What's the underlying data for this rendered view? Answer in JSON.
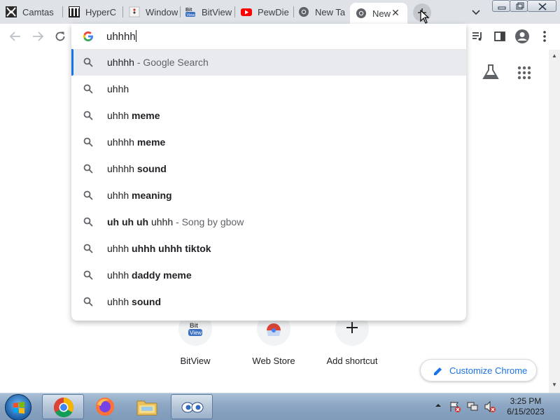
{
  "tabs": [
    {
      "title": "Camtas",
      "icon": "camtasia-icon"
    },
    {
      "title": "HyperC",
      "icon": "hypercam-icon"
    },
    {
      "title": "Window",
      "icon": "windows-icon"
    },
    {
      "title": "BitView",
      "icon": "bitview-icon"
    },
    {
      "title": "PewDie",
      "icon": "youtube-icon"
    },
    {
      "title": "New Ta",
      "icon": "chrome-icon"
    },
    {
      "title": "New",
      "icon": "chrome-icon",
      "active": true
    }
  ],
  "omnibox": {
    "text": "uhhhh"
  },
  "suggestions": [
    {
      "normal": "uhhhh",
      "bold": "",
      "desc": " - Google Search",
      "selected": true
    },
    {
      "normal": "uhhh",
      "bold": "",
      "desc": ""
    },
    {
      "normal": "uhhh ",
      "bold": "meme",
      "desc": ""
    },
    {
      "normal": "uhhhh ",
      "bold": "meme",
      "desc": ""
    },
    {
      "normal": "uhhhh ",
      "bold": "sound",
      "desc": ""
    },
    {
      "normal": "uhhh ",
      "bold": "meaning",
      "desc": ""
    },
    {
      "bold_first": "uh uh uh",
      "normal": " uhhh",
      "desc": " - Song by gbow"
    },
    {
      "normal": "uhhh ",
      "bold": "uhhh uhhh tiktok",
      "desc": ""
    },
    {
      "normal": "uhhh ",
      "bold": "daddy meme",
      "desc": ""
    },
    {
      "normal": "uhhh ",
      "bold": "sound",
      "desc": ""
    }
  ],
  "shortcuts": [
    {
      "label": "BitView",
      "icon": "bitview-icon"
    },
    {
      "label": "Web Store",
      "icon": "chrome-web-store-icon"
    },
    {
      "label": "Add shortcut",
      "icon": "plus-icon"
    }
  ],
  "customize": {
    "label": "Customize Chrome"
  },
  "taskbar": {
    "time": "3:25 PM",
    "date": "6/15/2023",
    "apps": [
      "chrome-icon",
      "firefox-icon",
      "file-explorer-icon",
      "eyes-app-icon"
    ]
  },
  "colors": {
    "accent": "#1a73e8",
    "tabstrip": "#dfe3e8",
    "selected_row": "#e8eaed"
  }
}
